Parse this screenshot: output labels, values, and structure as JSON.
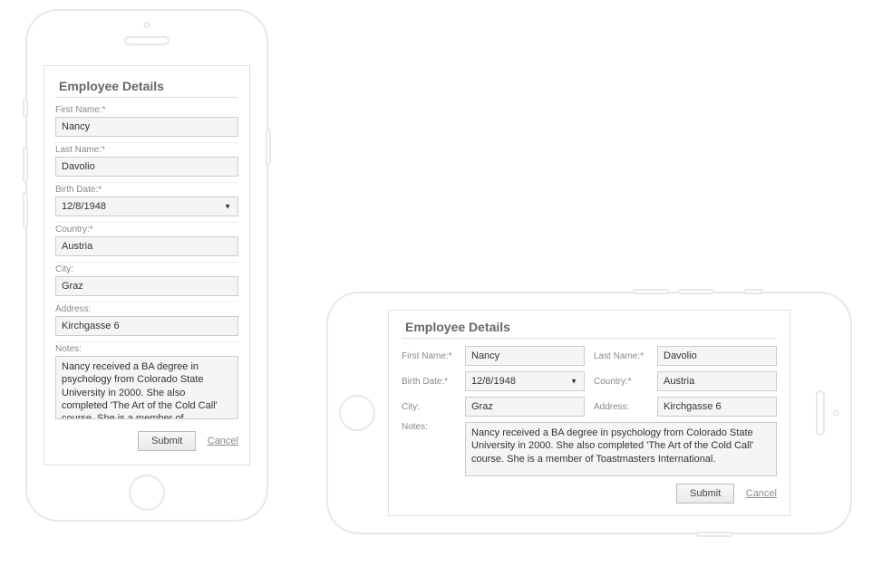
{
  "heading": "Employee Details",
  "fields": {
    "firstName": {
      "label": "First Name:*",
      "value": "Nancy"
    },
    "lastName": {
      "label": "Last Name:*",
      "value": "Davolio"
    },
    "birthDate": {
      "label": "Birth Date:*",
      "value": "12/8/1948"
    },
    "country": {
      "label": "Country:*",
      "value": "Austria"
    },
    "city": {
      "label": "City:",
      "value": "Graz"
    },
    "address": {
      "label": "Address:",
      "value": "Kirchgasse 6"
    },
    "notes": {
      "label": "Notes:",
      "value": "Nancy received a BA degree in psychology from Colorado State University in 2000. She also completed 'The Art of the Cold Call' course. She is a member of Toastmasters International."
    }
  },
  "buttons": {
    "submit": "Submit",
    "cancel": "Cancel"
  }
}
